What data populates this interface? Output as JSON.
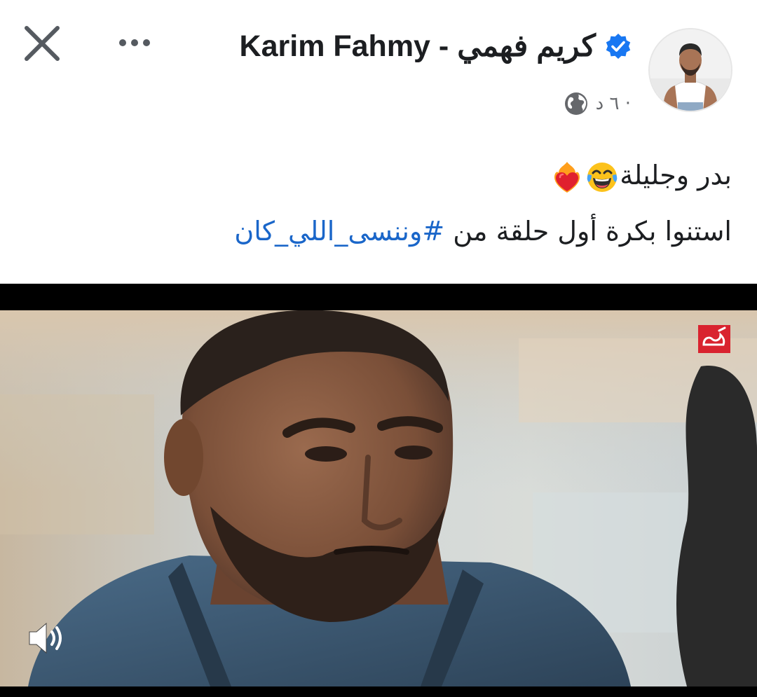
{
  "header": {
    "author_name": "Karim Fahmy - كريم فهمي",
    "verified": true,
    "timestamp": "٦ د ·",
    "audience_icon": "globe-icon",
    "close_icon": "close-icon",
    "more_icon": "more-options-icon"
  },
  "post": {
    "line1_text": "بدر وجليلة",
    "line1_emojis": [
      "face-with-tears-of-joy-emoji",
      "heart-on-fire-emoji"
    ],
    "line2_text": "استنوا بكرة أول حلقة من ",
    "hashtag": "#وننسى_اللي_كان"
  },
  "video": {
    "channel_logo": "mbc-masr-logo",
    "sound_icon": "speaker-volume-icon"
  },
  "colors": {
    "text_primary": "#1c1e21",
    "text_secondary": "#65676b",
    "hashtag": "#1a66c9",
    "verified_badge": "#1877f2",
    "channel_logo": "#d9232f"
  }
}
